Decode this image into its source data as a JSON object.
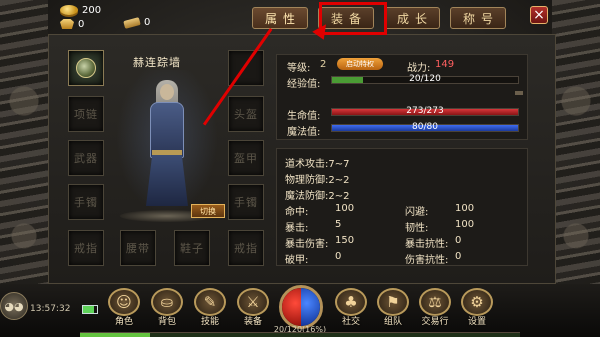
{
  "currency": {
    "gold": "200",
    "ingot": "0",
    "bound_gold": "0"
  },
  "tabs": [
    {
      "label": "属性",
      "active": true
    },
    {
      "label": "装备",
      "active": false
    },
    {
      "label": "成长",
      "active": false
    },
    {
      "label": "称号",
      "active": false
    }
  ],
  "close_label": "×",
  "character": {
    "name": "赫连踪墙",
    "swap_label": "切换"
  },
  "slots": {
    "left": [
      "",
      "项链",
      "武器",
      "手镯",
      "戒指"
    ],
    "right": [
      "",
      "头盔",
      "盔甲",
      "手镯",
      "戒指"
    ],
    "bottom": [
      "腰带",
      "鞋子"
    ]
  },
  "stats_top": {
    "level_label": "等级:",
    "level_value": "2",
    "activate_btn": "启动特权",
    "power_label": "战力:",
    "power_value": "149",
    "exp_label": "经验值:",
    "exp_text": "20/120",
    "exp_fraction": 0.167,
    "hp_label": "生命值:",
    "hp_text": "273/273",
    "hp_fraction": 1.0,
    "mp_label": "魔法值:",
    "mp_text": "80/80",
    "mp_fraction": 1.0
  },
  "stats_bottom": {
    "atk": "道术攻击:7~7",
    "pdef": "物理防御:2~2",
    "mdef": "魔法防御:2~2",
    "hit_label": "命中:",
    "hit": "100",
    "dodge_label": "闪避:",
    "dodge": "100",
    "crit_label": "暴击:",
    "crit": "5",
    "tough_label": "韧性:",
    "tough": "100",
    "critdmg_label": "暴击伤害:",
    "critdmg": "150",
    "critres_label": "暴击抗性:",
    "critres": "0",
    "armorpen_label": "破甲:",
    "armorpen": "0",
    "dmgres_label": "伤害抗性:",
    "dmgres": "0"
  },
  "hud": {
    "clock": "13:57:32",
    "exp_text": "20/120(16%)",
    "exp_fraction": 0.16,
    "face_label": "◕◕",
    "menu": [
      {
        "label": "角色",
        "icon": "☺"
      },
      {
        "label": "背包",
        "icon": "⛀"
      },
      {
        "label": "技能",
        "icon": "✎"
      },
      {
        "label": "装备",
        "icon": "⚔"
      },
      {
        "label": "社交",
        "icon": "♣"
      },
      {
        "label": "组队",
        "icon": "⚑"
      },
      {
        "label": "交易行",
        "icon": "⚖"
      },
      {
        "label": "设置",
        "icon": "⚙"
      }
    ]
  },
  "colors": {
    "highlight": "#e00000",
    "power": "#ff6060",
    "hp": "#c2262a",
    "mp": "#2f5ad8",
    "exp": "#4a9c34"
  }
}
